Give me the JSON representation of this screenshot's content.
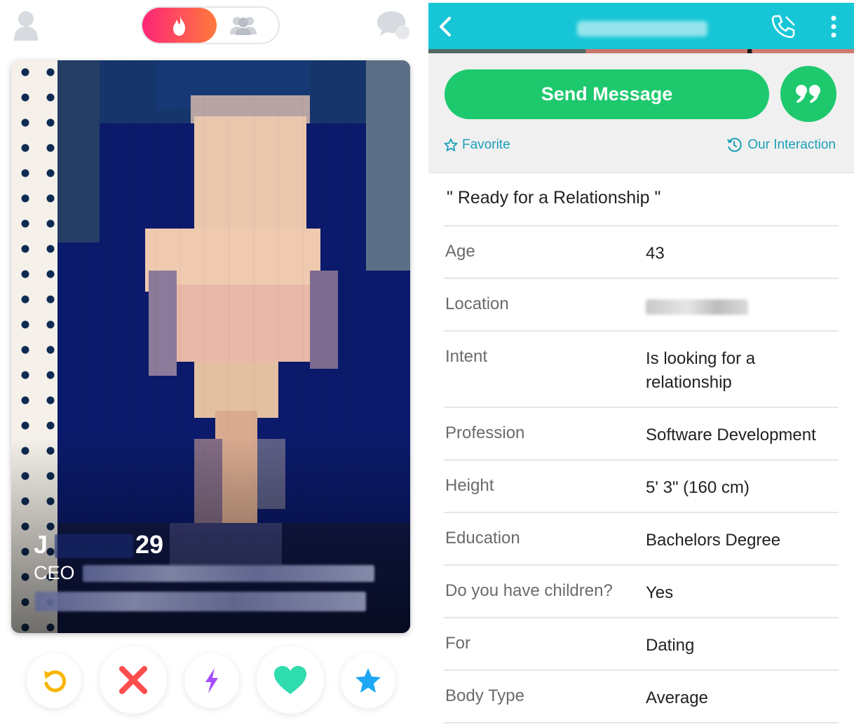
{
  "left_app": {
    "card": {
      "name_initial": "J",
      "age": "29",
      "job": "CEO"
    },
    "actions": {
      "rewind": "rewind-icon",
      "nope": "x-icon",
      "boost": "lightning-icon",
      "like": "heart-icon",
      "super_like": "star-icon"
    },
    "colors": {
      "brand_gradient_start": "#fd2577",
      "brand_gradient_end": "#ff7a3d",
      "rewind": "#f7b500",
      "nope": "#fd4d4d",
      "boost": "#a64dff",
      "like": "#2fdcae",
      "super_like": "#1ea7f5"
    }
  },
  "right_app": {
    "header_color": "#17c6d6",
    "send_message_label": "Send Message",
    "favorite_label": "Favorite",
    "interaction_label": "Our Interaction",
    "tagline": "\" Ready for a Relationship \"",
    "details": [
      {
        "label": "Age",
        "value": "43"
      },
      {
        "label": "Location",
        "value": ""
      },
      {
        "label": "Intent",
        "value": "Is looking for a relationship"
      },
      {
        "label": "Profession",
        "value": "Software Development"
      },
      {
        "label": "Height",
        "value": "5' 3\" (160 cm)"
      },
      {
        "label": "Education",
        "value": "Bachelors Degree"
      },
      {
        "label": "Do you have children?",
        "value": "Yes"
      },
      {
        "label": "For",
        "value": "Dating"
      },
      {
        "label": "Body Type",
        "value": "Average"
      }
    ],
    "accent": "#1ec96e",
    "link_color": "#1a9fb8"
  }
}
